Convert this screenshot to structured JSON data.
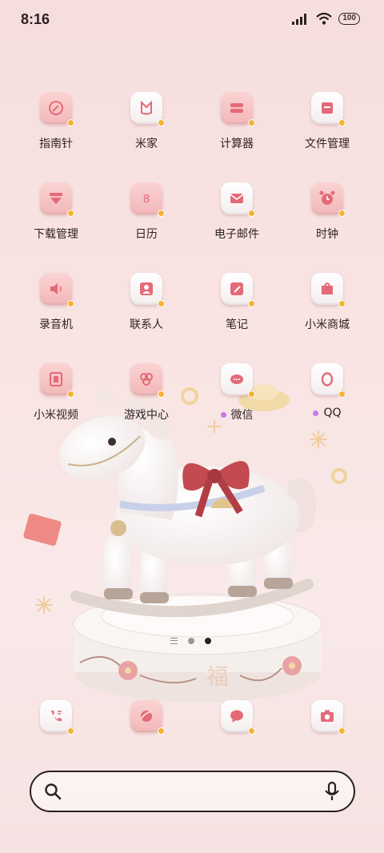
{
  "status_bar": {
    "time": "8:16",
    "battery": "100"
  },
  "apps": [
    {
      "label": "指南针",
      "icon": "compass-icon",
      "style": "pink"
    },
    {
      "label": "米家",
      "icon": "mijia-icon",
      "style": "white"
    },
    {
      "label": "计算器",
      "icon": "calculator-icon",
      "style": "pink"
    },
    {
      "label": "文件管理",
      "icon": "folder-icon",
      "style": "white"
    },
    {
      "label": "下载管理",
      "icon": "download-icon",
      "style": "pink"
    },
    {
      "label": "日历",
      "icon": "calendar-icon",
      "style": "pink",
      "glyph": "8"
    },
    {
      "label": "电子邮件",
      "icon": "mail-icon",
      "style": "white"
    },
    {
      "label": "时钟",
      "icon": "alarm-clock-icon",
      "style": "pink"
    },
    {
      "label": "录音机",
      "icon": "recorder-icon",
      "style": "pink"
    },
    {
      "label": "联系人",
      "icon": "contact-icon",
      "style": "white"
    },
    {
      "label": "笔记",
      "icon": "notes-icon",
      "style": "white"
    },
    {
      "label": "小米商城",
      "icon": "mi-store-icon",
      "style": "white"
    },
    {
      "label": "小米视频",
      "icon": "video-icon",
      "style": "pink"
    },
    {
      "label": "游戏中心",
      "icon": "game-center-icon",
      "style": "pink"
    },
    {
      "label": "微信",
      "icon": "wechat-icon",
      "style": "white",
      "new_dot": true
    },
    {
      "label": "QQ",
      "icon": "qq-icon",
      "style": "white",
      "new_dot": true
    }
  ],
  "dock": [
    {
      "icon": "phone-icon",
      "style": "white"
    },
    {
      "icon": "browser-icon",
      "style": "pink"
    },
    {
      "icon": "messages-icon",
      "style": "white"
    },
    {
      "icon": "camera-icon",
      "style": "white"
    }
  ],
  "pager": {
    "pages": 2,
    "active": 2
  },
  "wallpaper": {
    "character": "福"
  },
  "colors": {
    "accent_pink": "#f2b7b8",
    "badge": "#f5b234",
    "icon_stroke": "#e46a78",
    "new_dot": "#c77ae8"
  }
}
